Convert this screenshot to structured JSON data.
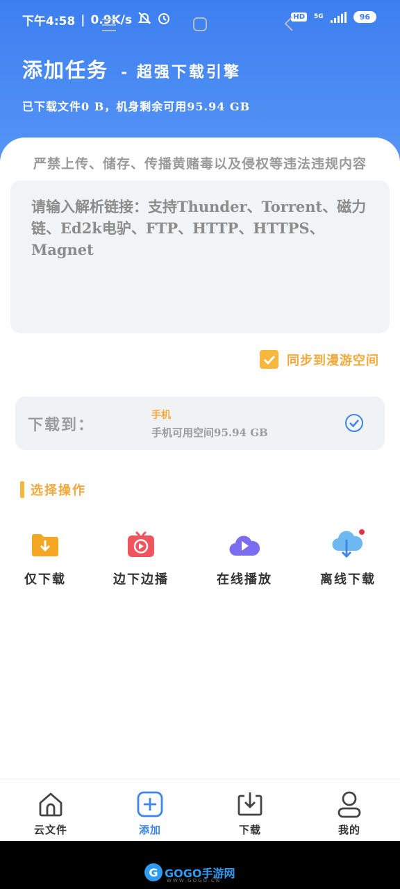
{
  "status_bar": {
    "time": "下午4:58",
    "separator": "|",
    "speed": "0.9K/s",
    "hd_badge": "HD",
    "network": "5G",
    "battery": "96"
  },
  "header": {
    "title": "添加任务",
    "subtitle": "- 超强下载引擎",
    "storage_info": "已下载文件0 B，机身剩余可用95.94 GB"
  },
  "warning": "严禁上传、储存、传播黄赌毒以及侵权等违法违规内容",
  "link_input": {
    "placeholder": "请输入解析链接：支持Thunder、Torrent、磁力链、Ed2k电驴、FTP、HTTP、HTTPS、Magnet",
    "value": ""
  },
  "sync": {
    "label": "同步到漫游空间",
    "checked": true
  },
  "destination": {
    "label": "下载到：",
    "name": "手机",
    "space": "手机可用空间95.94 GB"
  },
  "section": {
    "title": "选择操作"
  },
  "actions": [
    {
      "label": "仅下载",
      "icon": "folder-download-icon"
    },
    {
      "label": "边下边播",
      "icon": "tv-play-icon"
    },
    {
      "label": "在线播放",
      "icon": "cloud-play-icon"
    },
    {
      "label": "离线下载",
      "icon": "cloud-download-icon"
    }
  ],
  "tabs": [
    {
      "label": "云文件",
      "icon": "home-icon",
      "active": false
    },
    {
      "label": "添加",
      "icon": "add-icon",
      "active": true
    },
    {
      "label": "下载",
      "icon": "download-tray-icon",
      "active": false
    },
    {
      "label": "我的",
      "icon": "user-icon",
      "active": false
    }
  ],
  "watermark": {
    "logo": "G",
    "text": "GOGO手游网",
    "sub": "WWW.GOGO.CN"
  },
  "colors": {
    "header_blue": "#3d7ff0",
    "accent_orange": "#f2a93b",
    "tab_active": "#3d86e8"
  }
}
